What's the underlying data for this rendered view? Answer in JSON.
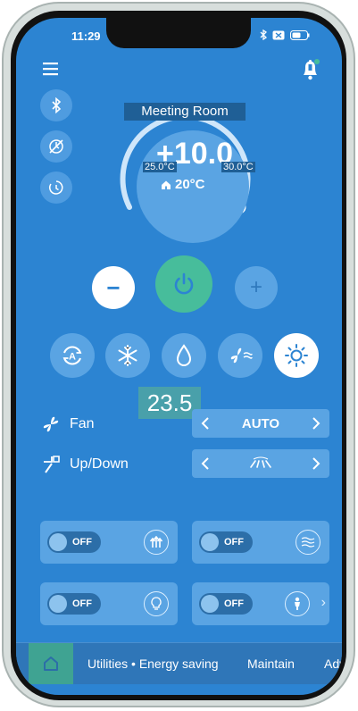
{
  "status_bar": {
    "time": "11:29"
  },
  "header": {
    "room_name": "Meeting Room"
  },
  "dial": {
    "setpoint": "+10.0",
    "range_min": "25.0°C",
    "range_max": "30.0°C",
    "room_temperature": "20°C"
  },
  "controls": {
    "minus_label": "−",
    "plus_label": "+"
  },
  "modes": [
    "auto",
    "cool",
    "dry",
    "fan",
    "heat"
  ],
  "overlay_value": "23.5",
  "fan": {
    "label": "Fan",
    "value": "AUTO"
  },
  "swing": {
    "label": "Up/Down"
  },
  "toggles": [
    {
      "state": "OFF",
      "icon": "airflow-up-icon"
    },
    {
      "state": "OFF",
      "icon": "wave-icon"
    },
    {
      "state": "OFF",
      "icon": "bulb-icon"
    },
    {
      "state": "OFF",
      "icon": "person-icon"
    }
  ],
  "bottom_nav": {
    "utilities": "Utilities",
    "energy": "Energy saving",
    "maintain": "Maintain",
    "adv": "Adv"
  },
  "colors": {
    "background": "#2c84d2",
    "card": "#5aa4e3",
    "power": "#47bd9b",
    "home_tab": "#3fa392"
  }
}
